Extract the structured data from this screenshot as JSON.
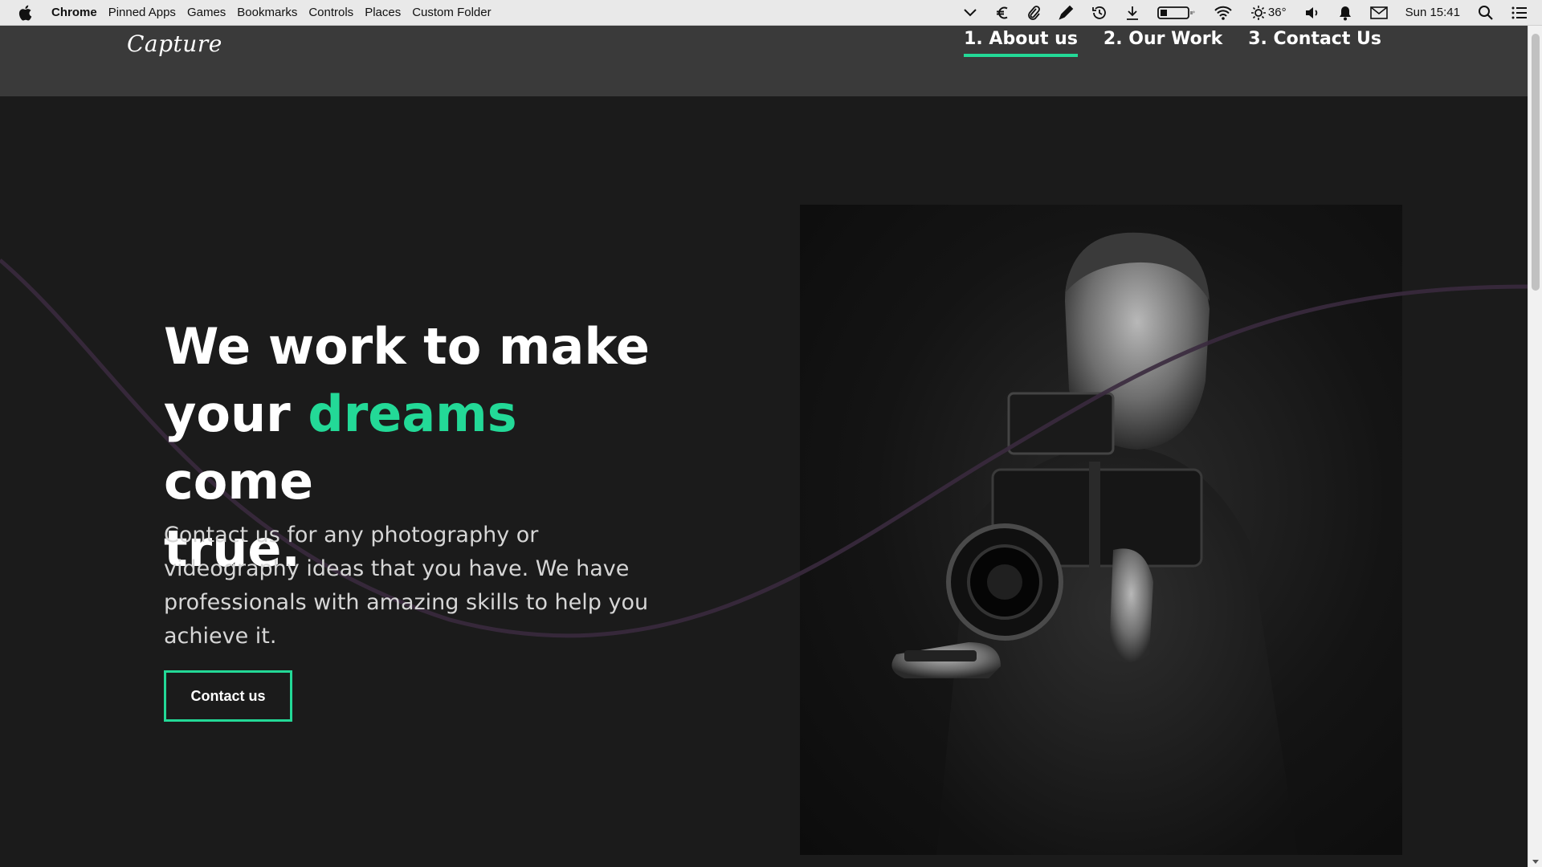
{
  "menubar": {
    "app": "Chrome",
    "items": [
      "Pinned Apps",
      "Games",
      "Bookmarks",
      "Controls",
      "Places",
      "Custom Folder"
    ],
    "weather": "36°",
    "clock": "Sun 15:41"
  },
  "site": {
    "logo": "Capture",
    "nav": [
      {
        "label": "1. About us",
        "active": true
      },
      {
        "label": "2. Our Work",
        "active": false
      },
      {
        "label": "3. Contact Us",
        "active": false
      }
    ],
    "accent_color": "#23d997"
  },
  "hero": {
    "title_line1": "We work to make",
    "title_before": "your",
    "title_accent": "dreams",
    "title_after": "come",
    "title_line3": "true.",
    "description": "Contact us for any photography or videography ideas that you have. We have professionals with amazing skills to help you achieve it.",
    "cta_label": "Contact us"
  }
}
